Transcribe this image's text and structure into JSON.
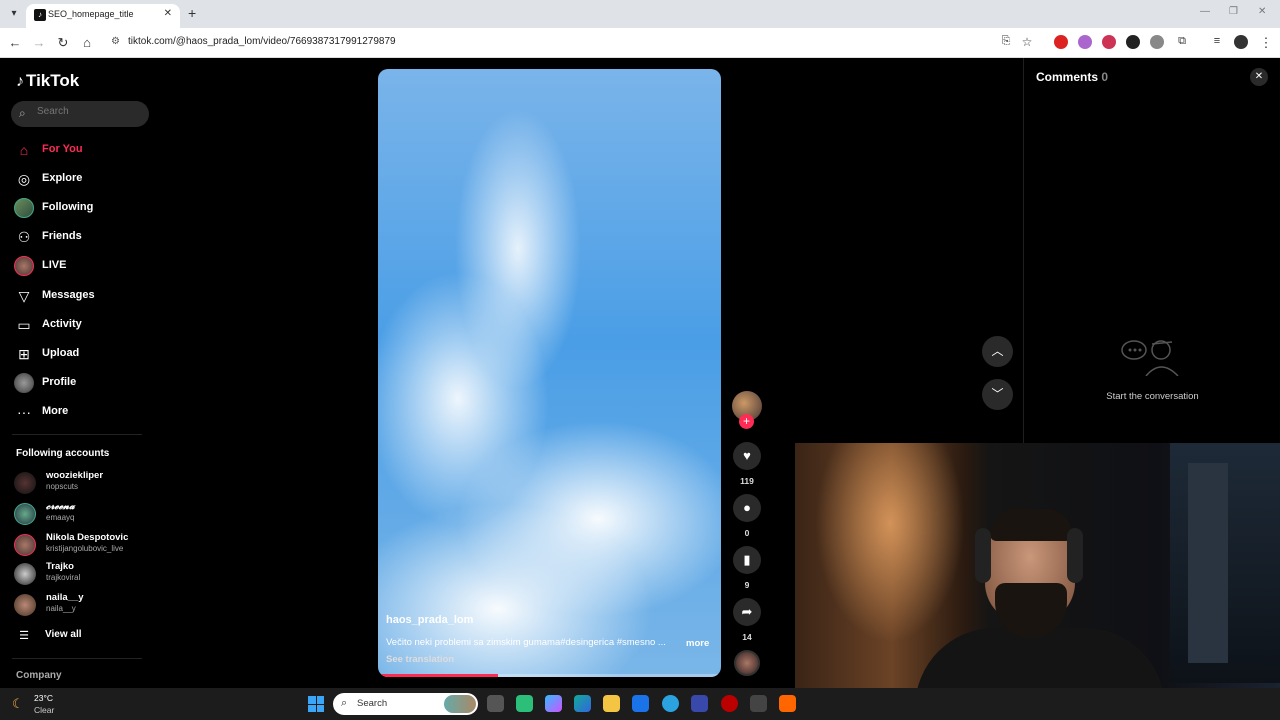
{
  "browser": {
    "tab_title": "SEO_homepage_title",
    "url": "tiktok.com/@haos_prada_lom/video/7669387317991279879"
  },
  "sidebar": {
    "logo": "TikTok",
    "search_placeholder": "Search",
    "nav": [
      {
        "label": "For You",
        "icon": "home-icon"
      },
      {
        "label": "Explore",
        "icon": "compass-icon"
      },
      {
        "label": "Following",
        "icon": "avatar-icon"
      },
      {
        "label": "Friends",
        "icon": "friends-icon"
      },
      {
        "label": "LIVE",
        "icon": "live-avatar-icon"
      },
      {
        "label": "Messages",
        "icon": "messages-icon"
      },
      {
        "label": "Activity",
        "icon": "activity-icon"
      },
      {
        "label": "Upload",
        "icon": "upload-icon"
      },
      {
        "label": "Profile",
        "icon": "profile-avatar-icon"
      },
      {
        "label": "More",
        "icon": "more-dots-icon"
      }
    ],
    "following_title": "Following accounts",
    "accounts": [
      {
        "name": "wooziekliper",
        "handle": "nopscuts"
      },
      {
        "name": "𝓬𝓻𝓮𝓮𝓷𝓪",
        "handle": "emaayq"
      },
      {
        "name": "Nikola Despotovic",
        "handle": "kristijangolubovic_live"
      },
      {
        "name": "Trajko",
        "handle": "trajkoviral"
      },
      {
        "name": "naila__y",
        "handle": "naila__y"
      }
    ],
    "view_all": "View all",
    "company": "Company"
  },
  "video": {
    "author": "haos_prada_lom",
    "description": "Večito neki problemi sa zimskim gumama#desingerica #smesno ...",
    "more": "more",
    "see_translation": "See translation",
    "progress": 0.35
  },
  "actions": {
    "likes": "119",
    "comments": "0",
    "saves": "9",
    "shares": "14"
  },
  "comments_panel": {
    "title": "Comments",
    "count": "0",
    "empty_text": "Start the conversation"
  },
  "taskbar": {
    "temperature": "23°C",
    "condition": "Clear",
    "search_label": "Search"
  },
  "colors": {
    "accent": "#fe2c55",
    "background": "#000000"
  }
}
